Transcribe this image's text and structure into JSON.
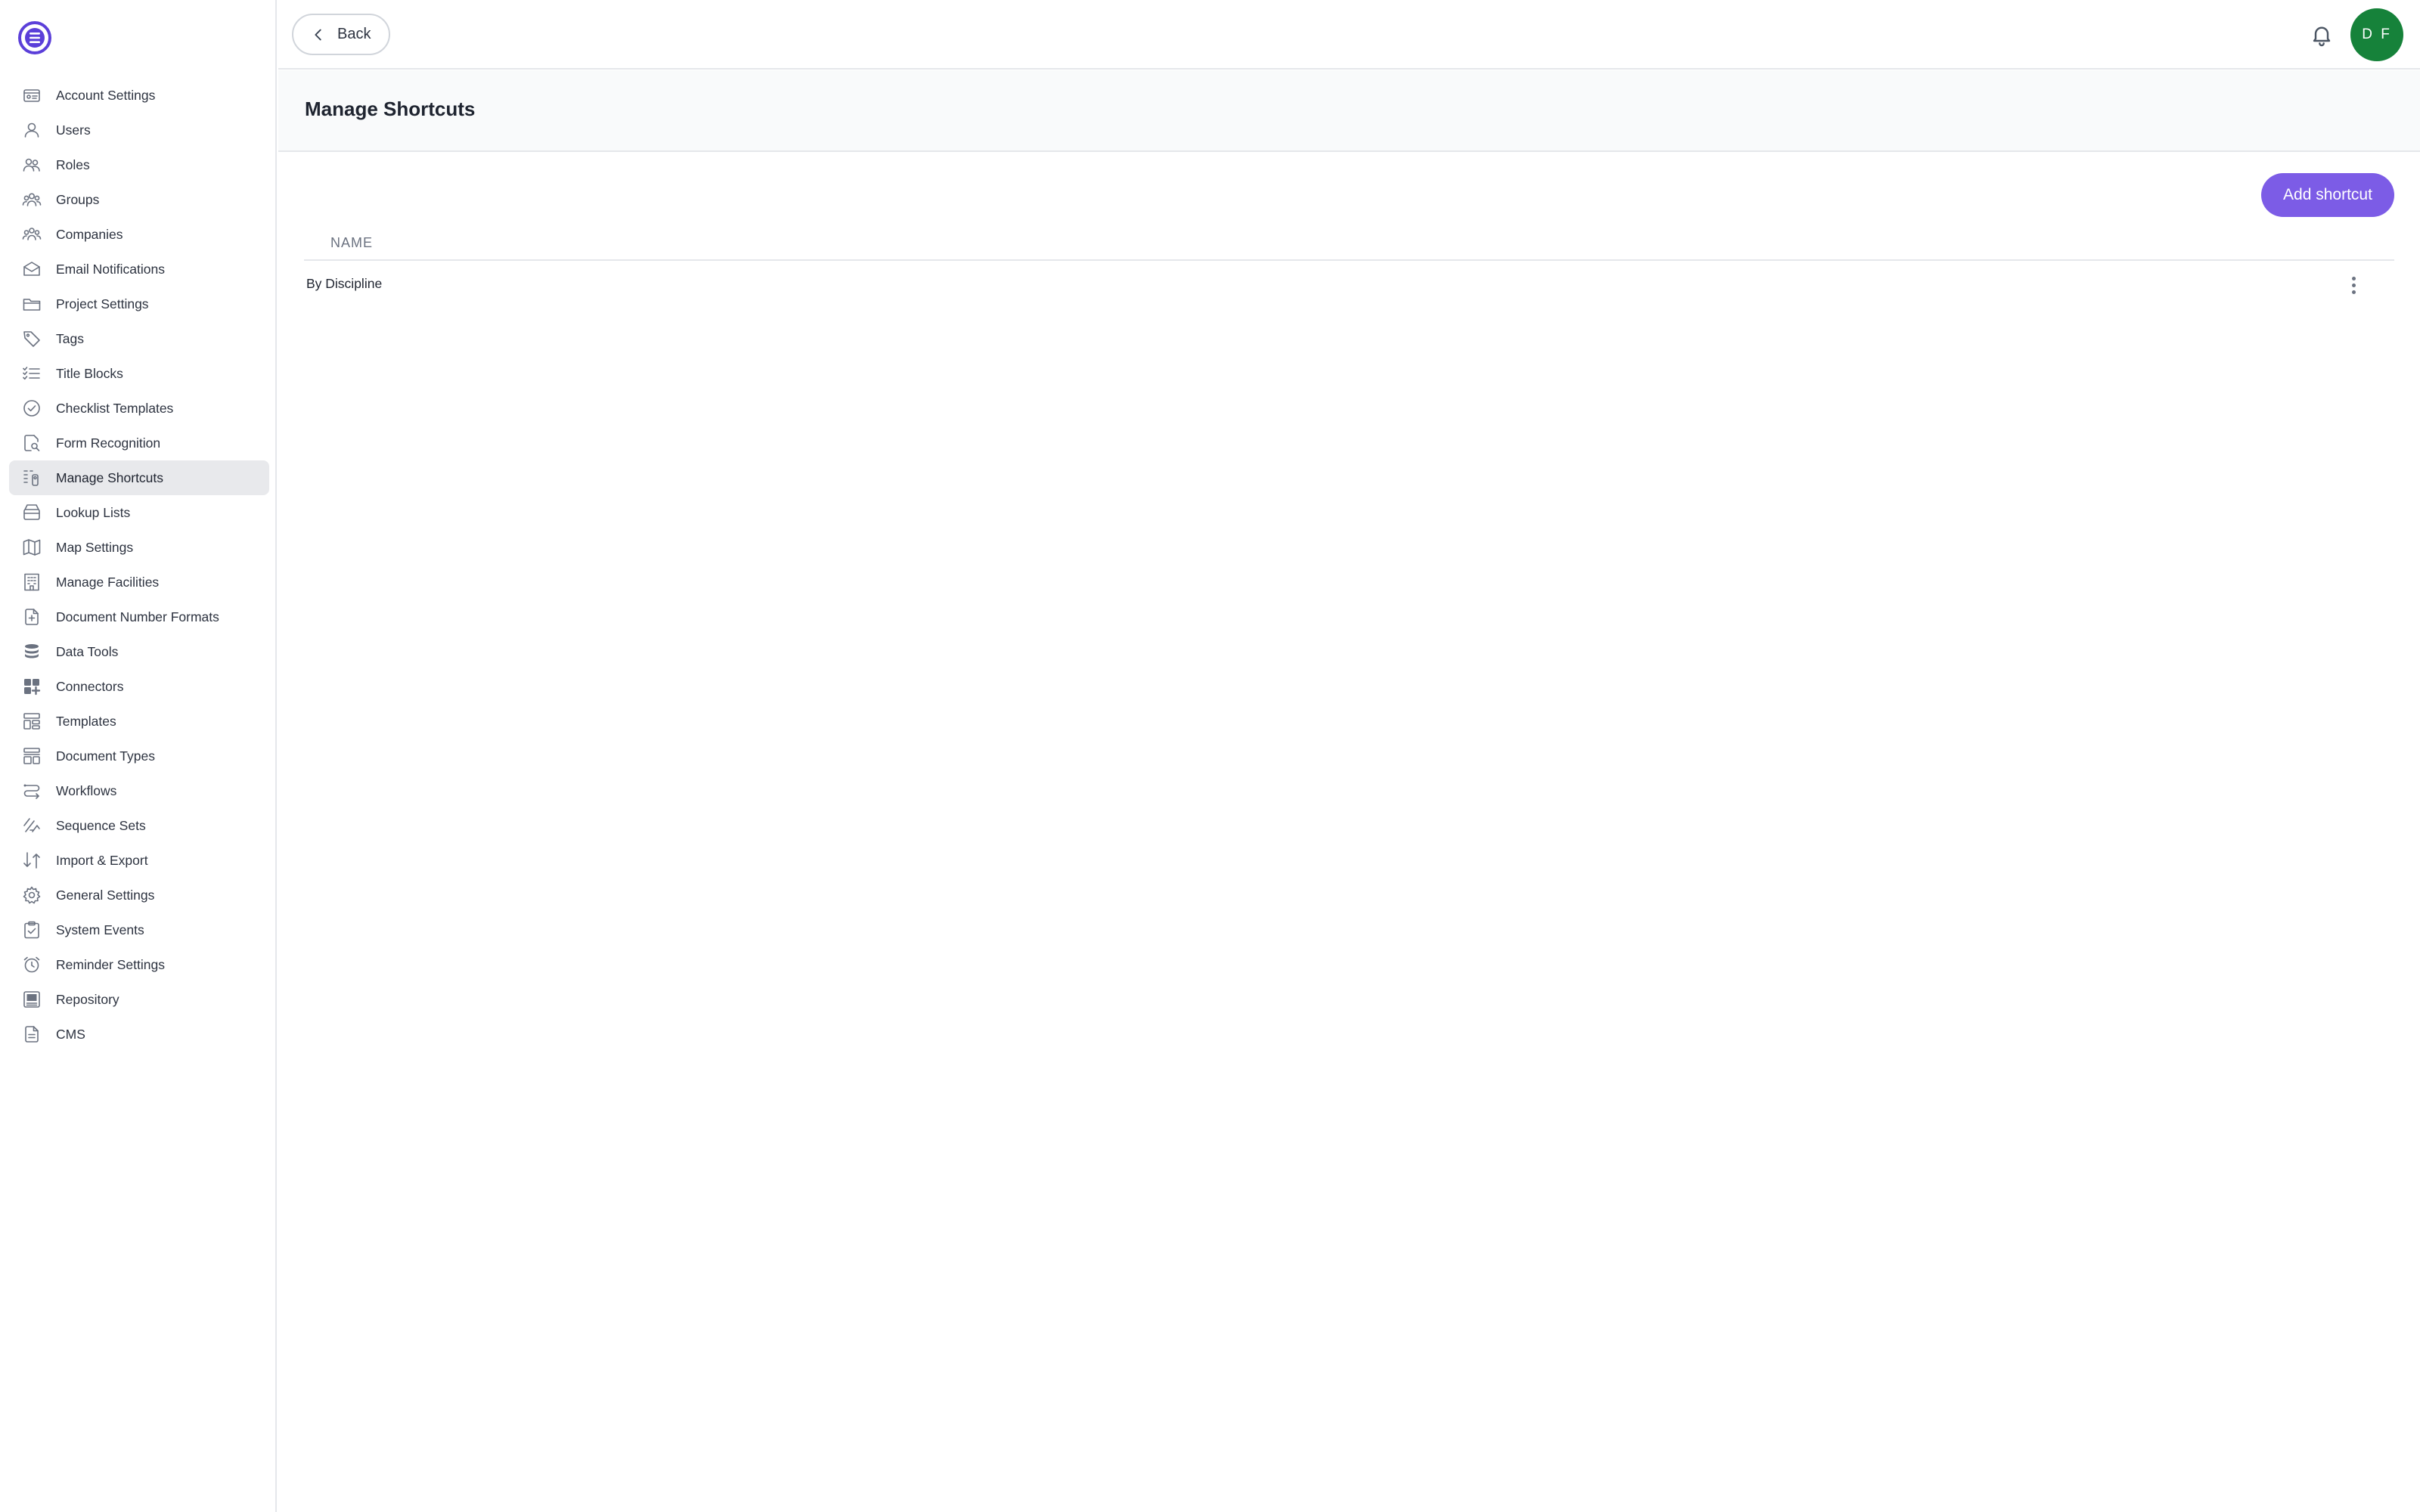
{
  "app": {
    "logo": "app-logo"
  },
  "sidebar": {
    "items": [
      {
        "label": "Account Settings",
        "icon": "account-settings-icon"
      },
      {
        "label": "Users",
        "icon": "user-icon"
      },
      {
        "label": "Roles",
        "icon": "roles-icon"
      },
      {
        "label": "Groups",
        "icon": "groups-icon"
      },
      {
        "label": "Companies",
        "icon": "companies-icon"
      },
      {
        "label": "Email Notifications",
        "icon": "envelope-icon"
      },
      {
        "label": "Project Settings",
        "icon": "folder-icon"
      },
      {
        "label": "Tags",
        "icon": "tag-icon"
      },
      {
        "label": "Title Blocks",
        "icon": "list-check-icon"
      },
      {
        "label": "Checklist Templates",
        "icon": "check-circle-icon"
      },
      {
        "label": "Form Recognition",
        "icon": "form-recognition-icon"
      },
      {
        "label": "Manage Shortcuts",
        "icon": "shortcuts-icon"
      },
      {
        "label": "Lookup Lists",
        "icon": "lookup-icon"
      },
      {
        "label": "Map Settings",
        "icon": "map-icon"
      },
      {
        "label": "Manage Facilities",
        "icon": "building-icon"
      },
      {
        "label": "Document Number Formats",
        "icon": "document-number-icon"
      },
      {
        "label": "Data Tools",
        "icon": "database-icon"
      },
      {
        "label": "Connectors",
        "icon": "connectors-icon"
      },
      {
        "label": "Templates",
        "icon": "templates-icon"
      },
      {
        "label": "Document Types",
        "icon": "document-types-icon"
      },
      {
        "label": "Workflows",
        "icon": "workflow-icon"
      },
      {
        "label": "Sequence Sets",
        "icon": "sequence-icon"
      },
      {
        "label": "Import & Export",
        "icon": "import-export-icon"
      },
      {
        "label": "General Settings",
        "icon": "gear-icon"
      },
      {
        "label": "System Events",
        "icon": "clipboard-check-icon"
      },
      {
        "label": "Reminder Settings",
        "icon": "alarm-clock-icon"
      },
      {
        "label": "Repository",
        "icon": "repository-icon"
      },
      {
        "label": "CMS",
        "icon": "file-text-icon"
      }
    ],
    "active_index": 11
  },
  "topbar": {
    "back_label": "Back",
    "avatar_initials": "D F",
    "avatar_color": "#16823a"
  },
  "page": {
    "title": "Manage Shortcuts",
    "add_button_label": "Add shortcut",
    "accent_color": "#7c5ce6"
  },
  "table": {
    "columns": [
      "NAME"
    ],
    "rows": [
      {
        "name": "By Discipline"
      }
    ]
  }
}
